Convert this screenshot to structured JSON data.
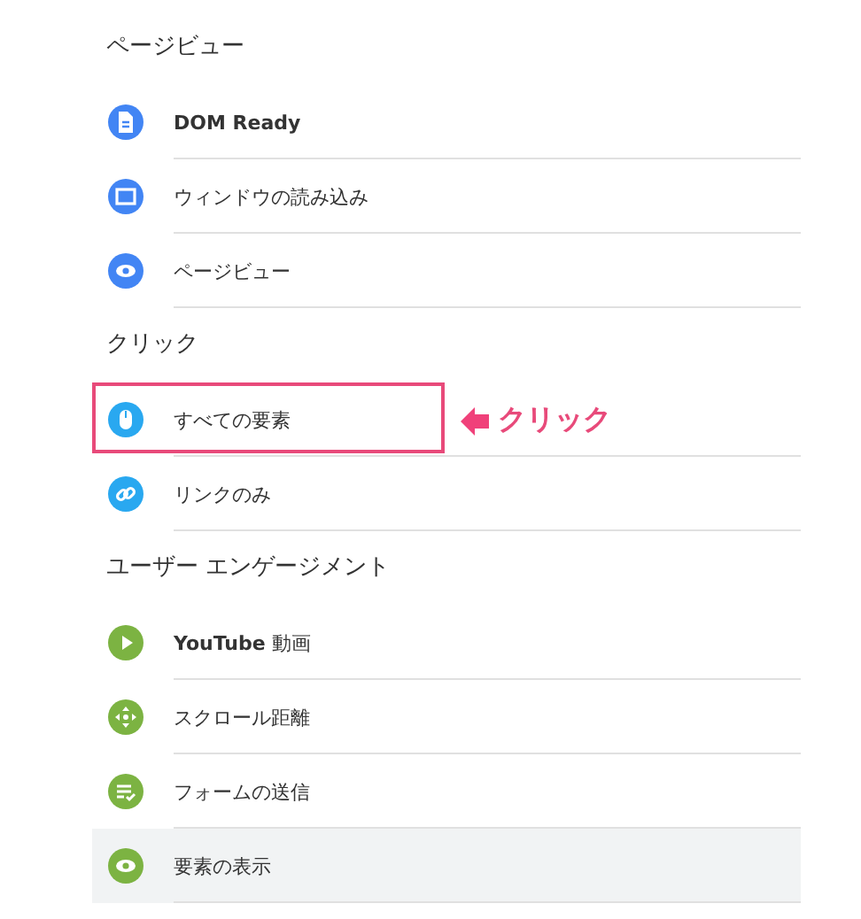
{
  "sections": [
    {
      "title": "ページビュー",
      "items": [
        {
          "label": "DOM Ready",
          "bold": true,
          "kind": "document",
          "color": "#4285f4",
          "selected": false
        },
        {
          "label": "ウィンドウの読み込み",
          "kind": "window",
          "color": "#4285f4",
          "selected": false
        },
        {
          "label": "ページビュー",
          "kind": "eye",
          "color": "#4285f4",
          "selected": false
        }
      ]
    },
    {
      "title": "クリック",
      "items": [
        {
          "label": "すべての要素",
          "kind": "mouse",
          "color": "#29a8f0",
          "selected": false,
          "callout": "クリック"
        },
        {
          "label": "リンクのみ",
          "kind": "link",
          "color": "#29a8f0",
          "selected": false
        }
      ]
    },
    {
      "title": "ユーザー エンゲージメント",
      "items": [
        {
          "label": "**YouTube** 動画",
          "kind": "play",
          "color": "#7cb342",
          "selected": false
        },
        {
          "label": "スクロール距離",
          "kind": "move",
          "color": "#7cb342",
          "selected": false
        },
        {
          "label": "フォームの送信",
          "kind": "form",
          "color": "#7cb342",
          "selected": false
        },
        {
          "label": "要素の表示",
          "kind": "eye",
          "color": "#7cb342",
          "selected": true
        }
      ]
    }
  ]
}
